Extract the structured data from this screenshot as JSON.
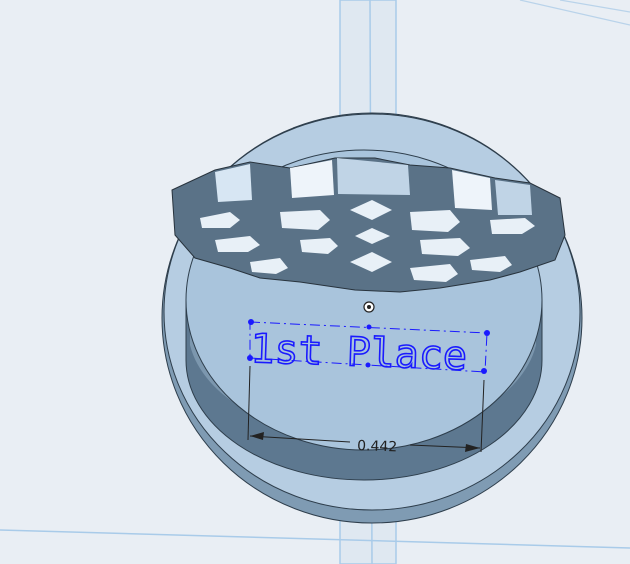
{
  "viewport": {
    "sketch_text": "1st Place",
    "dimension_value": "0.442",
    "colors": {
      "background": "#e9eef4",
      "part": "#a9c4dc",
      "part_dark": "#5d7890",
      "sketch": "#1a1aff",
      "plane": "#9dc3e6"
    }
  }
}
